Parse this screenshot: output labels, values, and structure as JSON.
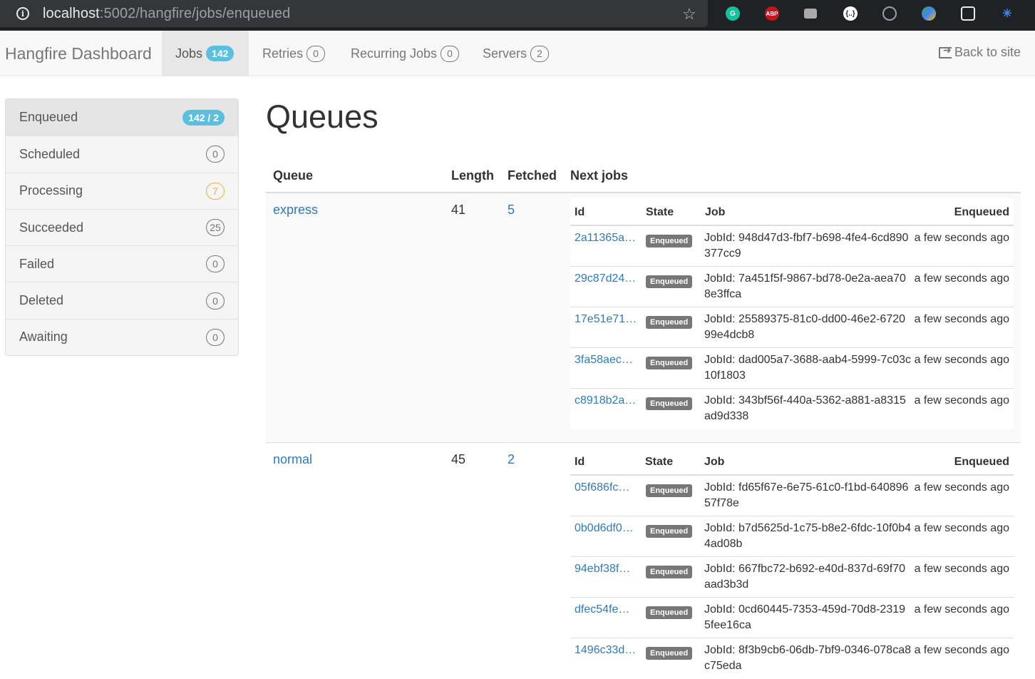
{
  "browser": {
    "url_host": "localhost",
    "url_path": ":5002/hangfire/jobs/enqueued"
  },
  "navbar": {
    "brand": "Hangfire Dashboard",
    "jobs_label": "Jobs",
    "jobs_count": "142",
    "retries_label": "Retries",
    "retries_count": "0",
    "recurring_label": "Recurring Jobs",
    "recurring_count": "0",
    "servers_label": "Servers",
    "servers_count": "2",
    "back_label": "Back to site"
  },
  "sidebar": {
    "items": [
      {
        "label": "Enqueued",
        "count": "142 / 2"
      },
      {
        "label": "Scheduled",
        "count": "0"
      },
      {
        "label": "Processing",
        "count": "7"
      },
      {
        "label": "Succeeded",
        "count": "25"
      },
      {
        "label": "Failed",
        "count": "0"
      },
      {
        "label": "Deleted",
        "count": "0"
      },
      {
        "label": "Awaiting",
        "count": "0"
      }
    ]
  },
  "main": {
    "title": "Queues",
    "headers": {
      "queue": "Queue",
      "length": "Length",
      "fetched": "Fetched",
      "next_jobs": "Next jobs"
    },
    "inner_headers": {
      "id": "Id",
      "state": "State",
      "job": "Job",
      "enqueued": "Enqueued"
    },
    "queues": [
      {
        "name": "express",
        "length": "41",
        "fetched": "5",
        "jobs": [
          {
            "id": "2a11365a…",
            "state": "Enqueued",
            "job": "JobId: 948d47d3-fbf7-b698-4fe4-6cd890377cc9",
            "enqueued": "a few seconds ago"
          },
          {
            "id": "29c87d24…",
            "state": "Enqueued",
            "job": "JobId: 7a451f5f-9867-bd78-0e2a-aea708e3ffca",
            "enqueued": "a few seconds ago"
          },
          {
            "id": "17e51e71…",
            "state": "Enqueued",
            "job": "JobId: 25589375-81c0-dd00-46e2-672099e4dcb8",
            "enqueued": "a few seconds ago"
          },
          {
            "id": "3fa58aec…",
            "state": "Enqueued",
            "job": "JobId: dad005a7-3688-aab4-5999-7c03c10f1803",
            "enqueued": "a few seconds ago"
          },
          {
            "id": "c8918b2a…",
            "state": "Enqueued",
            "job": "JobId: 343bf56f-440a-5362-a881-a8315ad9d338",
            "enqueued": "a few seconds ago"
          }
        ]
      },
      {
        "name": "normal",
        "length": "45",
        "fetched": "2",
        "jobs": [
          {
            "id": "05f686fc…",
            "state": "Enqueued",
            "job": "JobId: fd65f67e-6e75-61c0-f1bd-64089657f78e",
            "enqueued": "a few seconds ago"
          },
          {
            "id": "0b0d6df0…",
            "state": "Enqueued",
            "job": "JobId: b7d5625d-1c75-b8e2-6fdc-10f0b44ad08b",
            "enqueued": "a few seconds ago"
          },
          {
            "id": "94ebf38f…",
            "state": "Enqueued",
            "job": "JobId: 667fbc72-b692-e40d-837d-69f70aad3b3d",
            "enqueued": "a few seconds ago"
          },
          {
            "id": "dfec54fe…",
            "state": "Enqueued",
            "job": "JobId: 0cd60445-7353-459d-70d8-23195fee16ca",
            "enqueued": "a few seconds ago"
          },
          {
            "id": "1496c33d…",
            "state": "Enqueued",
            "job": "JobId: 8f3b9cb6-06db-7bf9-0346-078ca8c75eda",
            "enqueued": "a few seconds ago"
          }
        ]
      }
    ]
  }
}
